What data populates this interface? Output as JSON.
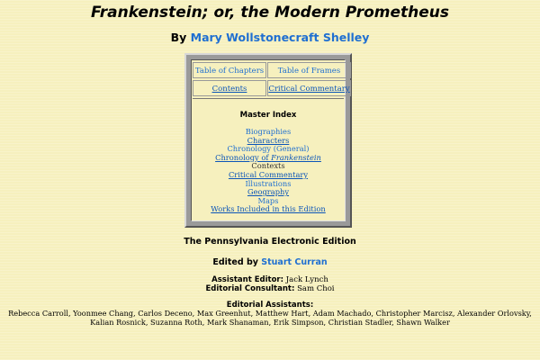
{
  "page": {
    "title": "Frankenstein; or, the Modern Prometheus",
    "by_prefix": "By",
    "author": "Mary Wollstonecraft Shelley"
  },
  "nav": {
    "table_of_chapters": "Table of Chapters",
    "table_of_frames": "Table of Frames",
    "contents": "Contents",
    "critical_commentary": "Critical Commentary"
  },
  "master_index": {
    "title": "Master Index",
    "items": [
      {
        "label": "Biographies",
        "link": false
      },
      {
        "label": "Characters",
        "link": true
      },
      {
        "label": "Chronology (General)",
        "link": false
      },
      {
        "label": "Chronology of Frankenstein",
        "link": true
      },
      {
        "label": "Contexts",
        "link": false
      },
      {
        "label": "Critical Commentary",
        "link": true
      },
      {
        "label": "Illustrations",
        "link": false
      },
      {
        "label": "Geography",
        "link": true
      },
      {
        "label": "Maps",
        "link": false
      },
      {
        "label": "Works Included in this Edition",
        "link": true
      }
    ]
  },
  "edition": "The Pennsylvania Electronic Edition",
  "edited": {
    "prefix": "Edited by",
    "editor": "Stuart Curran"
  },
  "staff": {
    "assistant_editor_label": "Assistant Editor:",
    "assistant_editor": "Jack Lynch",
    "editorial_consultant_label": "Editorial Consultant:",
    "editorial_consultant": "Sam Choi"
  },
  "editorial_assistants": {
    "heading": "Editorial Assistants:",
    "names_line1": "Rebecca Carroll, Yoonmee Chang, Carlos Deceno, Max Greenhut, Matthew Hart, Adam Machado, Christopher Marcisz, Alexander Orlovsky,",
    "names_line2": "Kalian Rosnick, Suzanna Roth, Mark Shanaman, Erik Simpson, Christian Stadler, Shawn Walker"
  },
  "colors": {
    "background": "#f6f0be",
    "link": "#1f6fd1",
    "frame": "#9a9a9a"
  }
}
